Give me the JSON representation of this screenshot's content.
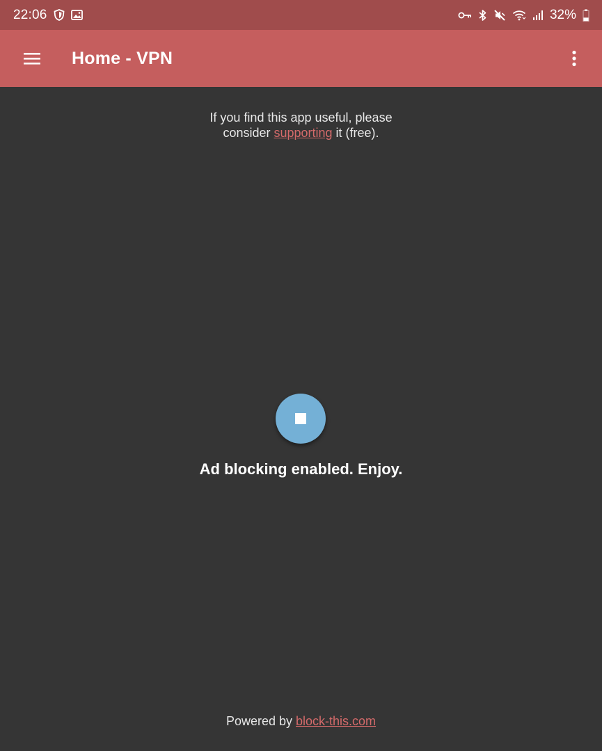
{
  "status_bar": {
    "time": "22:06",
    "left_icons": [
      "shield-icon",
      "image-icon"
    ],
    "right_icons": [
      "vpn-key-icon",
      "bluetooth-icon",
      "mute-icon",
      "wifi-icon",
      "signal-icon"
    ],
    "battery_percent": "32%",
    "battery_level": 0.32
  },
  "app_bar": {
    "title": "Home - VPN",
    "menu_icon": "hamburger-menu-icon",
    "overflow_icon": "more-vert-icon"
  },
  "support": {
    "line1": "If you find this app useful, please",
    "prefix": "consider ",
    "link_text": "supporting",
    "suffix": " it (free)."
  },
  "toggle": {
    "icon": "stop-icon",
    "state": "enabled"
  },
  "status_message": "Ad blocking enabled. Enjoy.",
  "footer": {
    "prefix": "Powered by ",
    "link_text": "block-this.com"
  },
  "colors": {
    "status_bar_bg": "#a04c4c",
    "app_bar_bg": "#c55e5e",
    "background": "#353535",
    "link": "#d46a6a",
    "toggle_bg": "#74b0d6"
  }
}
